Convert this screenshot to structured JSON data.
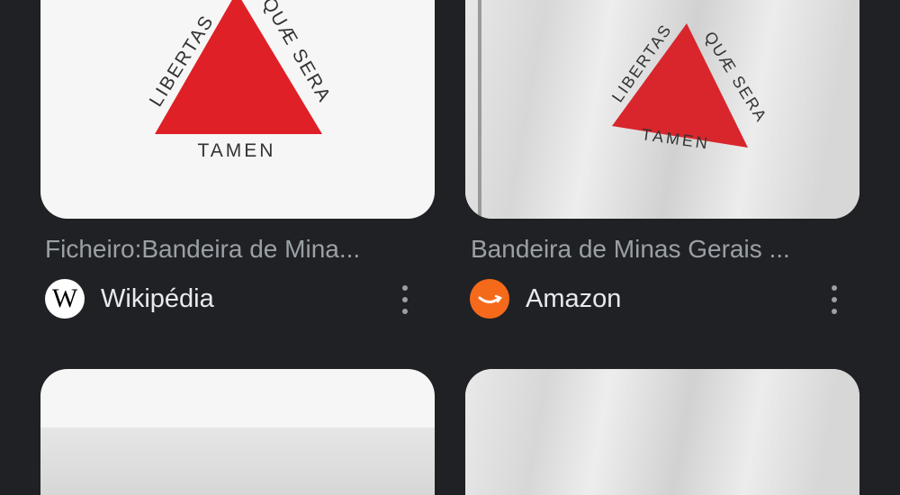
{
  "results": [
    {
      "title": "Ficheiro:Bandeira de Mina...",
      "source": "Wikipédia",
      "favicon": "wikipedia-w-icon",
      "flag_text": {
        "left": "LIBERTAS",
        "right": "QUÆ SERA",
        "bottom": "TAMEN"
      }
    },
    {
      "title": "Bandeira de Minas Gerais ...",
      "source": "Amazon",
      "favicon": "amazon-smile-icon",
      "flag_text": {
        "left": "LIBERTAS",
        "right": "QUÆ SERA",
        "bottom": "TAMEN"
      }
    }
  ],
  "colors": {
    "background": "#202124",
    "flag_red": "#e02027",
    "amazon_orange": "#f56a1a"
  }
}
